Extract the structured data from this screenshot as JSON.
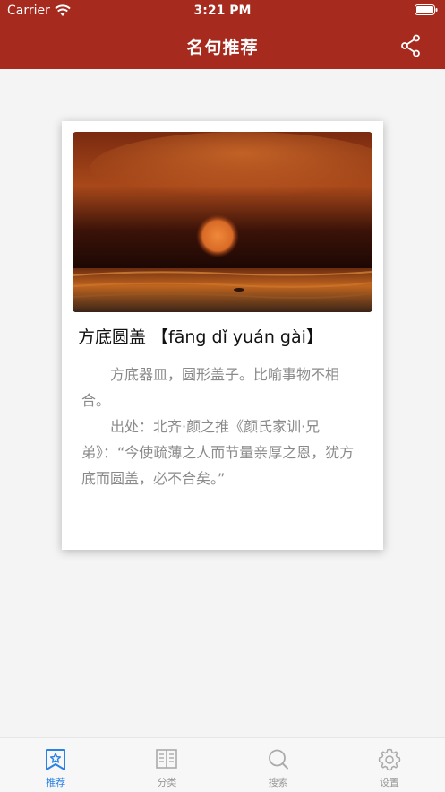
{
  "status_bar": {
    "carrier": "Carrier",
    "time": "3:21 PM"
  },
  "nav": {
    "title": "名句推荐",
    "share_icon": "share-icon"
  },
  "card": {
    "image_description": "sunset-over-water",
    "title": "方底圆盖 【fāng dǐ yuán gài】",
    "meaning": "方底器皿，圆形盖子。比喻事物不相合。",
    "source": "出处：北齐·颜之推《颜氏家训·兄弟》：“今使疏薄之人而节量亲厚之恩，犹方底而圆盖，必不合矣。”"
  },
  "tabs": [
    {
      "label": "推荐",
      "icon": "bookmark-star-icon",
      "active": true
    },
    {
      "label": "分类",
      "icon": "book-icon",
      "active": false
    },
    {
      "label": "搜索",
      "icon": "search-icon",
      "active": false
    },
    {
      "label": "设置",
      "icon": "gear-icon",
      "active": false
    }
  ],
  "colors": {
    "header": "#a72a1e",
    "active_tab": "#2a82e4",
    "inactive_tab": "#999999",
    "body_text": "#8a8a8a"
  }
}
